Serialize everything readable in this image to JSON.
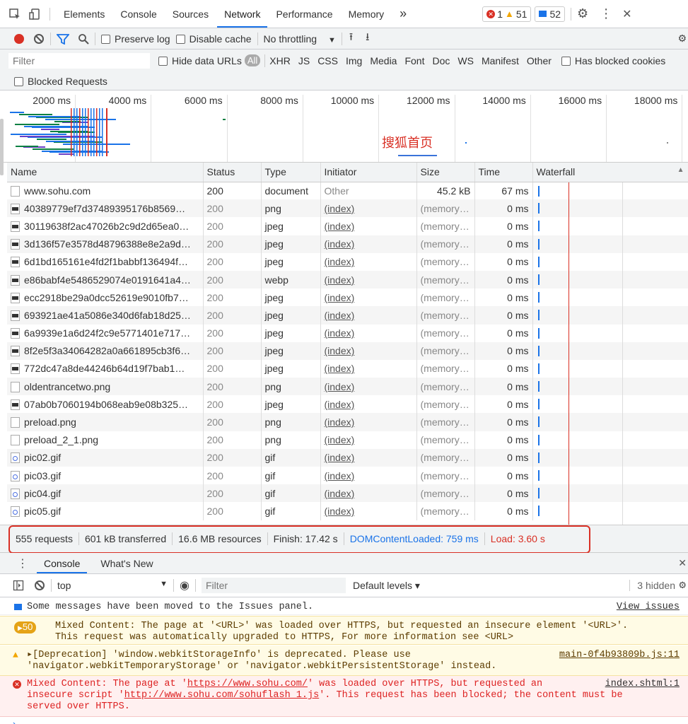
{
  "toolbar": {
    "tabs": [
      "Elements",
      "Console",
      "Sources",
      "Network",
      "Performance",
      "Memory"
    ],
    "more": "»",
    "errors": "1",
    "warnings": "51",
    "info": "52"
  },
  "network_bar": {
    "preserve_log": "Preserve log",
    "disable_cache": "Disable cache",
    "throttling": "No throttling"
  },
  "filter_bar": {
    "placeholder": "Filter",
    "hide_data_urls": "Hide data URLs",
    "types": [
      "All",
      "XHR",
      "JS",
      "CSS",
      "Img",
      "Media",
      "Font",
      "Doc",
      "WS",
      "Manifest",
      "Other"
    ],
    "has_blocked": "Has blocked cookies",
    "blocked_requests": "Blocked Requests"
  },
  "overview": {
    "ticks": [
      "2000 ms",
      "4000 ms",
      "6000 ms",
      "8000 ms",
      "10000 ms",
      "12000 ms",
      "14000 ms",
      "16000 ms",
      "18000 ms"
    ],
    "annotation": "搜狐首页"
  },
  "table": {
    "headers": [
      "Name",
      "Status",
      "Type",
      "Initiator",
      "Size",
      "Time",
      "Waterfall"
    ],
    "rows": [
      {
        "name": "www.sohu.com",
        "status": "200",
        "type": "document",
        "initiator": "Other",
        "size": "45.2 kB",
        "time": "67 ms",
        "icon": "document-icon"
      },
      {
        "name": "40389779ef7d37489395176b8569…",
        "status": "200",
        "type": "png",
        "initiator": "(index)",
        "size": "(memory…",
        "time": "0 ms",
        "icon": "image-icon"
      },
      {
        "name": "30119638f2ac47026b2c9d2d65ea0…",
        "status": "200",
        "type": "jpeg",
        "initiator": "(index)",
        "size": "(memory…",
        "time": "0 ms",
        "icon": "image-icon"
      },
      {
        "name": "3d136f57e3578d48796388e8e2a9d…",
        "status": "200",
        "type": "jpeg",
        "initiator": "(index)",
        "size": "(memory…",
        "time": "0 ms",
        "icon": "image-icon"
      },
      {
        "name": "6d1bd165161e4fd2f1babbf136494f…",
        "status": "200",
        "type": "jpeg",
        "initiator": "(index)",
        "size": "(memory…",
        "time": "0 ms",
        "icon": "image-icon"
      },
      {
        "name": "e86babf4e5486529074e0191641a4…",
        "status": "200",
        "type": "webp",
        "initiator": "(index)",
        "size": "(memory…",
        "time": "0 ms",
        "icon": "image-icon"
      },
      {
        "name": "ecc2918be29a0dcc52619e9010fb7…",
        "status": "200",
        "type": "jpeg",
        "initiator": "(index)",
        "size": "(memory…",
        "time": "0 ms",
        "icon": "image-icon"
      },
      {
        "name": "693921ae41a5086e340d6fab18d25…",
        "status": "200",
        "type": "jpeg",
        "initiator": "(index)",
        "size": "(memory…",
        "time": "0 ms",
        "icon": "image-icon"
      },
      {
        "name": "6a9939e1a6d24f2c9e5771401e717…",
        "status": "200",
        "type": "jpeg",
        "initiator": "(index)",
        "size": "(memory…",
        "time": "0 ms",
        "icon": "image-icon"
      },
      {
        "name": "8f2e5f3a34064282a0a661895cb3f6…",
        "status": "200",
        "type": "jpeg",
        "initiator": "(index)",
        "size": "(memory…",
        "time": "0 ms",
        "icon": "image-icon"
      },
      {
        "name": "772dc47a8de44246b64d19f7bab1…",
        "status": "200",
        "type": "jpeg",
        "initiator": "(index)",
        "size": "(memory…",
        "time": "0 ms",
        "icon": "image-icon"
      },
      {
        "name": "oldentrancetwo.png",
        "status": "200",
        "type": "png",
        "initiator": "(index)",
        "size": "(memory…",
        "time": "0 ms",
        "icon": "file-icon"
      },
      {
        "name": "07ab0b7060194b068eab9e08b325…",
        "status": "200",
        "type": "jpeg",
        "initiator": "(index)",
        "size": "(memory…",
        "time": "0 ms",
        "icon": "image-icon"
      },
      {
        "name": "preload.png",
        "status": "200",
        "type": "png",
        "initiator": "(index)",
        "size": "(memory…",
        "time": "0 ms",
        "icon": "file-icon"
      },
      {
        "name": "preload_2_1.png",
        "status": "200",
        "type": "png",
        "initiator": "(index)",
        "size": "(memory…",
        "time": "0 ms",
        "icon": "file-icon"
      },
      {
        "name": "pic02.gif",
        "status": "200",
        "type": "gif",
        "initiator": "(index)",
        "size": "(memory…",
        "time": "0 ms",
        "icon": "gif-icon"
      },
      {
        "name": "pic03.gif",
        "status": "200",
        "type": "gif",
        "initiator": "(index)",
        "size": "(memory…",
        "time": "0 ms",
        "icon": "gif-icon"
      },
      {
        "name": "pic04.gif",
        "status": "200",
        "type": "gif",
        "initiator": "(index)",
        "size": "(memory…",
        "time": "0 ms",
        "icon": "gif-icon"
      },
      {
        "name": "pic05.gif",
        "status": "200",
        "type": "gif",
        "initiator": "(index)",
        "size": "(memory…",
        "time": "0 ms",
        "icon": "gif-icon"
      }
    ]
  },
  "summary": {
    "requests": "555 requests",
    "transferred": "601 kB transferred",
    "resources": "16.6 MB resources",
    "finish": "Finish: 17.42 s",
    "dom_content_loaded": "DOMContentLoaded: 759 ms",
    "load": "Load: 3.60 s",
    "dcl_color": "#1a73e8",
    "load_color": "#d93025"
  },
  "drawer": {
    "tabs": [
      "Console",
      "What's New"
    ],
    "context": "top",
    "filter_placeholder": "Filter",
    "levels": "Default levels ▾",
    "hidden": "3 hidden"
  },
  "console": {
    "m1": "Some messages have been moved to the Issues panel.",
    "m1_link": "View issues",
    "m2_count": "50",
    "m2_line1": "Mixed Content: The page at '<URL>' was loaded over HTTPS, but requested an insecure element '<URL>'.",
    "m2_line2": "This request was automatically upgraded to HTTPS, For more information see <URL>",
    "m3_line1": "▸[Deprecation] 'window.webkitStorageInfo' is deprecated. Please use",
    "m3_line2": "'navigator.webkitTemporaryStorage' or 'navigator.webkitPersistentStorage' instead.",
    "m3_src": "main-0f4b93809b.js:11",
    "m4_p1": "Mixed Content: The page at '",
    "m4_url1": "https://www.sohu.com/",
    "m4_p2": "' was loaded over HTTPS, but requested an",
    "m4_p3": "insecure script '",
    "m4_url2": "http://www.sohu.com/sohuflash_1.js",
    "m4_p4": "'. This request has been blocked; the content must be",
    "m4_p5": "served over HTTPS.",
    "m4_src": "index.shtml:1"
  }
}
